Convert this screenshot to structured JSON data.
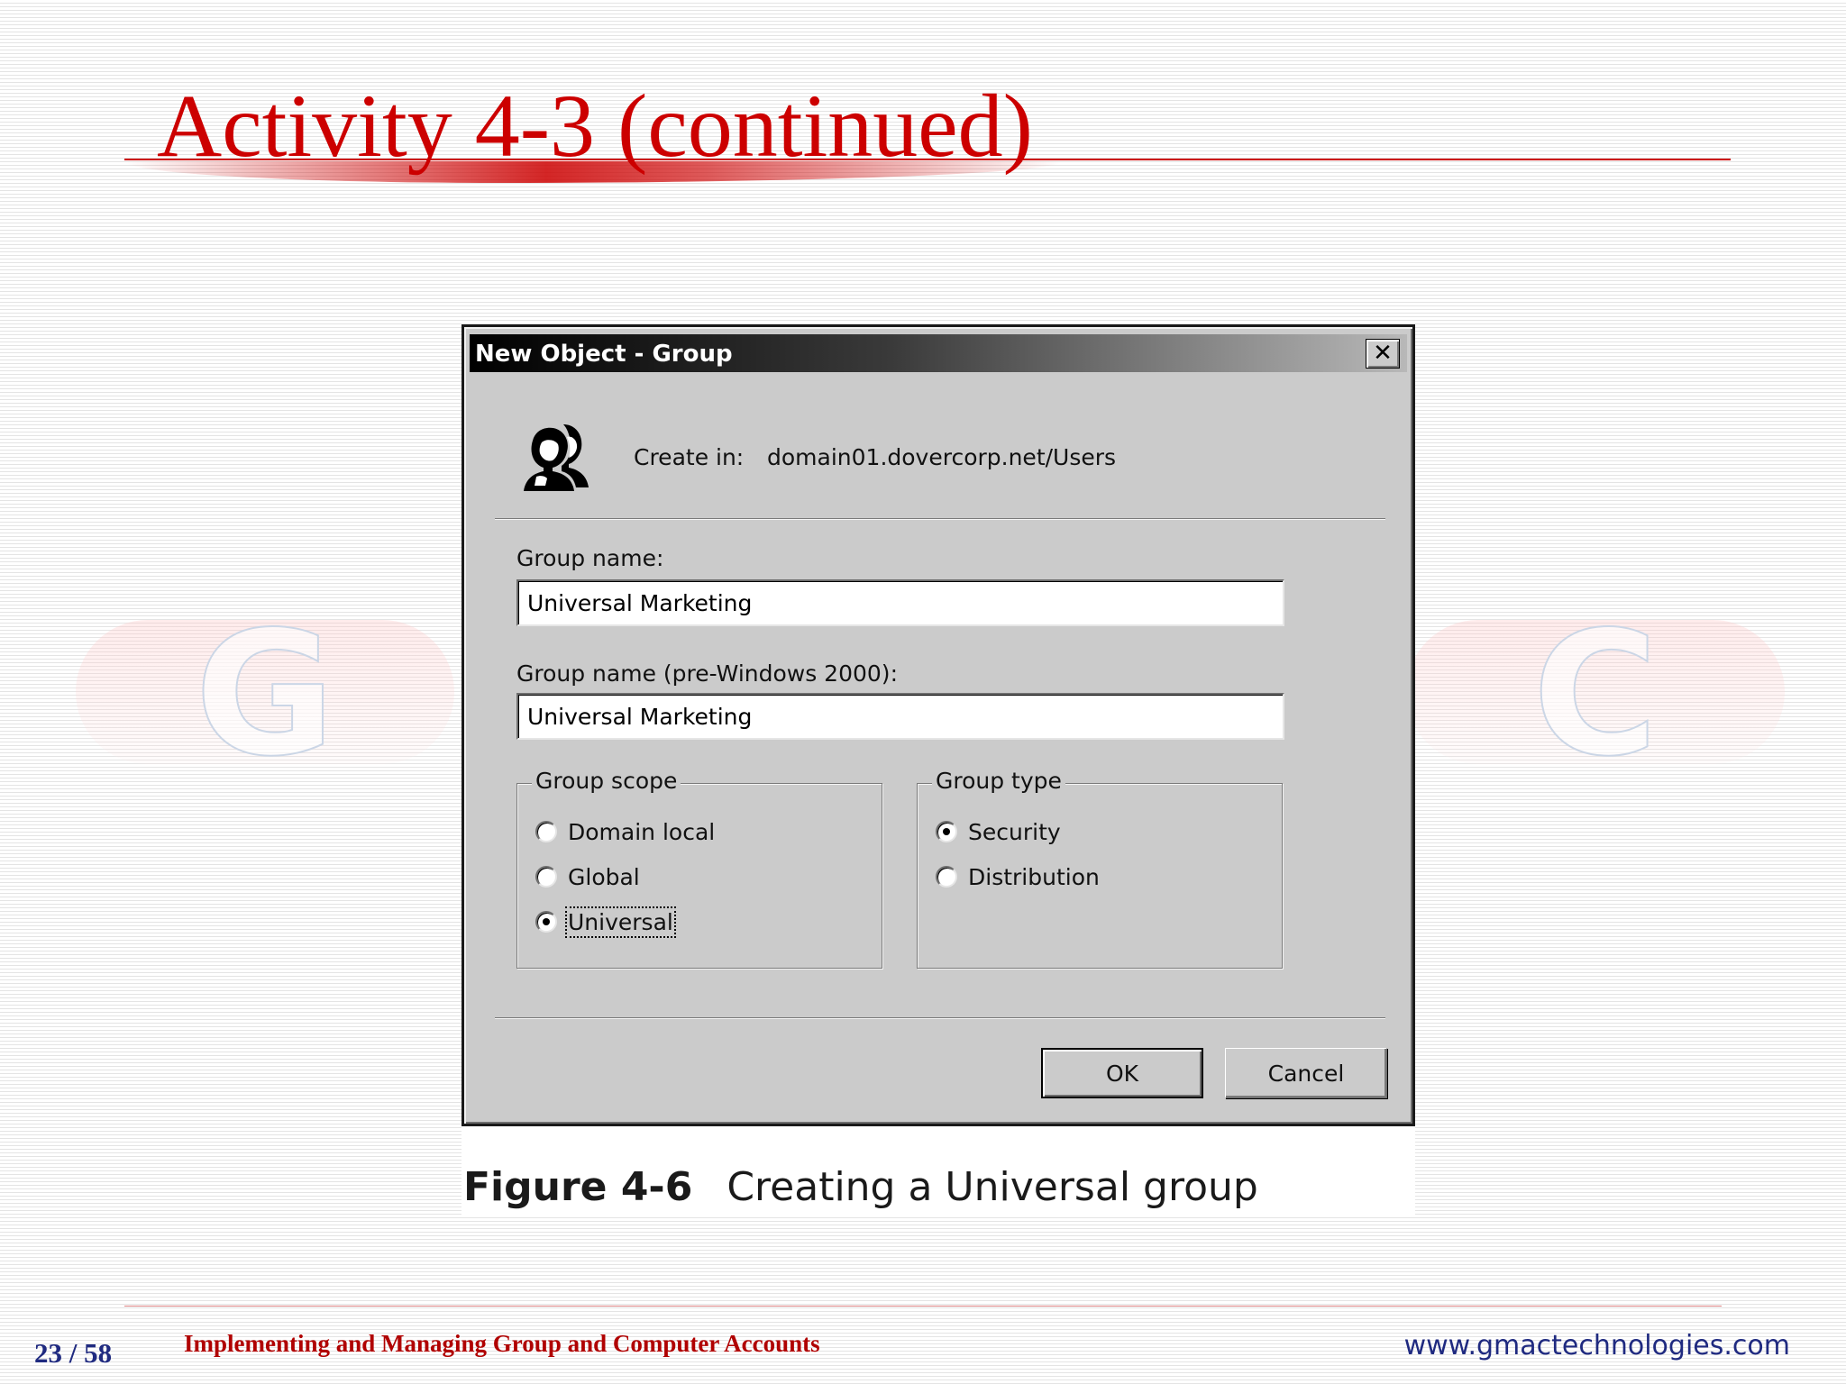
{
  "slide": {
    "title": "Activity 4-3 (continued)",
    "watermark_left": "G",
    "watermark_right": "C"
  },
  "dialog": {
    "title": "New Object - Group",
    "close_glyph": "✕",
    "icon": "group-users-icon",
    "create_in_label": "Create in:",
    "create_in_value": "domain01.dovercorp.net/Users",
    "group_name_label": "Group name:",
    "group_name_value": "Universal Marketing",
    "pre_windows_label": "Group name (pre-Windows 2000):",
    "pre_windows_value": "Universal Marketing",
    "group_scope": {
      "legend": "Group scope",
      "options": [
        {
          "label": "Domain local",
          "selected": false
        },
        {
          "label": "Global",
          "selected": false
        },
        {
          "label": "Universal",
          "selected": true
        }
      ]
    },
    "group_type": {
      "legend": "Group type",
      "options": [
        {
          "label": "Security",
          "selected": true
        },
        {
          "label": "Distribution",
          "selected": false
        }
      ]
    },
    "ok_label": "OK",
    "cancel_label": "Cancel"
  },
  "figure": {
    "label": "Figure 4-6",
    "caption": "Creating a Universal group"
  },
  "footer": {
    "page": "23 / 58",
    "title": "Implementing and Managing Group and Computer Accounts",
    "url": "www.gmactechnologies.com"
  },
  "colors": {
    "title_red": "#cc0000",
    "dialog_gray": "#cbcbcb",
    "footer_blue": "#1f2a80"
  }
}
